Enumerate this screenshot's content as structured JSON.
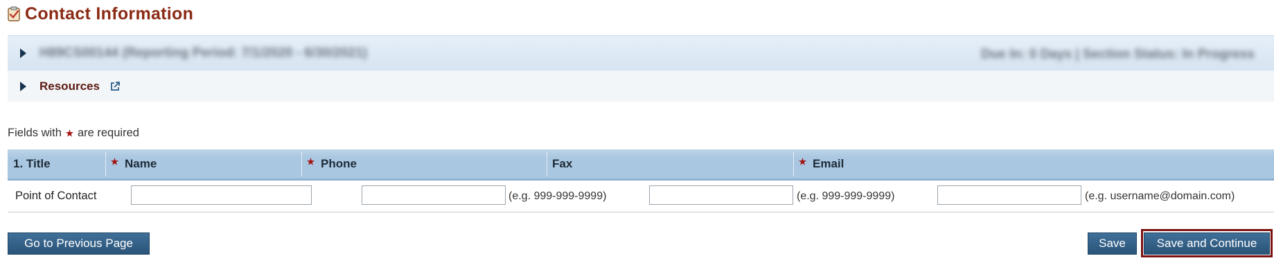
{
  "page": {
    "title": "Contact Information"
  },
  "accordion": {
    "header_left": "H89CS00144 (Reporting Period: 7/1/2020 - 6/30/2021)",
    "header_right": "Due In: 0 Days | Section Status: In Progress",
    "resources_label": "Resources"
  },
  "required_note": {
    "before": "Fields with",
    "after": "are required"
  },
  "table": {
    "columns": [
      "1. Title",
      "Name",
      "Phone",
      "Fax",
      "Email"
    ],
    "row": {
      "label": "Point of Contact",
      "name_value": "",
      "phone_value": "",
      "phone_hint": "(e.g. 999-999-9999)",
      "fax_value": "",
      "fax_hint": "(e.g. 999-999-9999)",
      "email_value": "",
      "email_hint": "(e.g. username@domain.com)"
    }
  },
  "buttons": {
    "previous": "Go to Previous Page",
    "save": "Save",
    "save_continue": "Save and Continue"
  },
  "colors": {
    "title": "#8b2a15",
    "required_star": "#a31515",
    "button": "#2f5d85",
    "focus_outline": "#7a1210"
  },
  "icons": {
    "title": "clipboard-check-icon",
    "accordion": "triangle-right-icon",
    "resources": "external-link-icon",
    "required": "star-icon"
  }
}
